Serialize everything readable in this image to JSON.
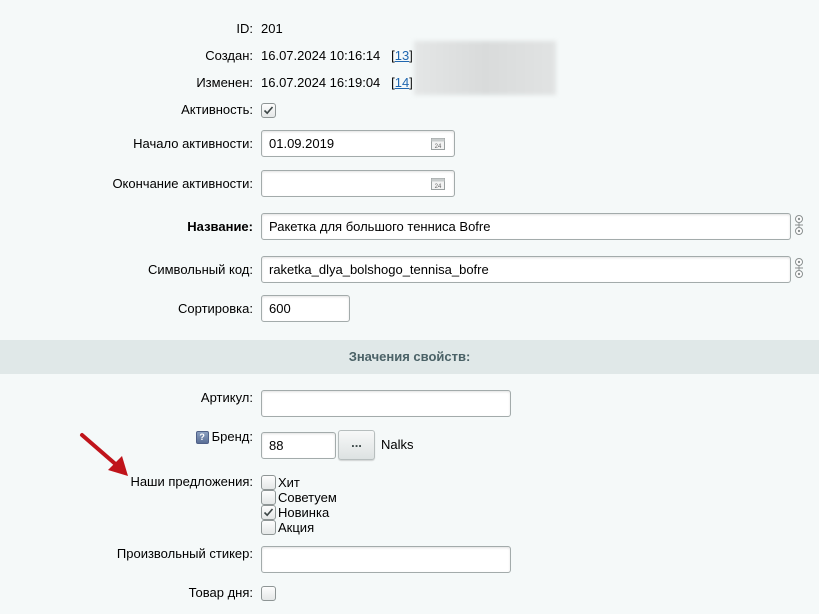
{
  "meta": {
    "id_label": "ID:",
    "id_value": "201",
    "created_label": "Создан:",
    "created_value": "16.07.2024 10:16:14",
    "created_user": "13",
    "modified_label": "Изменен:",
    "modified_value": "16.07.2024 16:19:04",
    "modified_user": "14"
  },
  "fields": {
    "active_label": "Активность:",
    "active_checked": true,
    "active_from_label": "Начало активности:",
    "active_from_value": "01.09.2019",
    "active_to_label": "Окончание активности:",
    "active_to_value": "",
    "name_label": "Название:",
    "name_value": "Ракетка для большого тенниса Bofre",
    "code_label": "Символьный код:",
    "code_value": "raketka_dlya_bolshogo_tennisa_bofre",
    "sort_label": "Сортировка:",
    "sort_value": "600"
  },
  "properties": {
    "section_title": "Значения свойств:",
    "article_label": "Артикул:",
    "article_value": "",
    "brand_label": "Бренд:",
    "brand_value": "88",
    "brand_button": "...",
    "brand_name": "Nalks",
    "offers_label": "Наши предложения:",
    "offers": [
      {
        "label": "Хит",
        "checked": false
      },
      {
        "label": "Советуем",
        "checked": false
      },
      {
        "label": "Новинка",
        "checked": true
      },
      {
        "label": "Акция",
        "checked": false
      }
    ],
    "sticker_label": "Произвольный стикер:",
    "sticker_value": "",
    "deal_label": "Товар дня:",
    "deal_checked": false
  },
  "colors": {
    "annotation_arrow": "#c0141b",
    "section_bg": "#e0e8e8",
    "link": "#2067b0"
  },
  "icons": [
    "calendar-icon",
    "help-icon",
    "transliterate-icon",
    "checkmark-icon",
    "annotation-arrow"
  ]
}
